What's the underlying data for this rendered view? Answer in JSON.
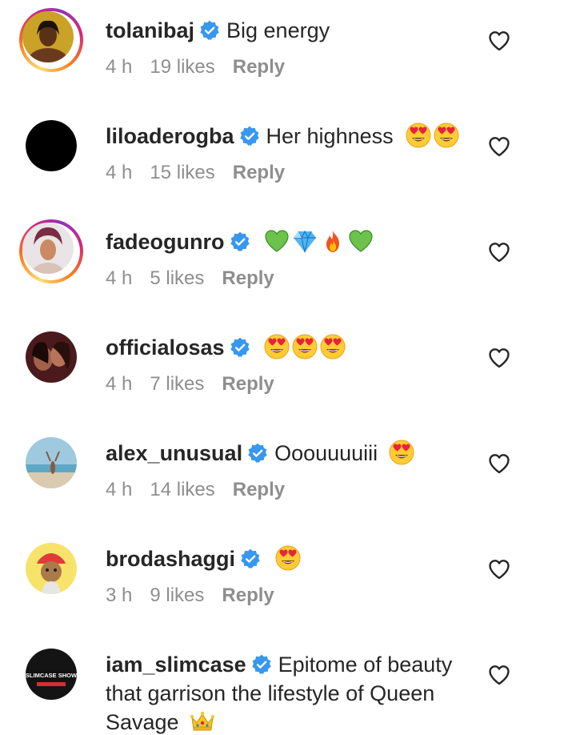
{
  "comments": [
    {
      "username": "tolanibaj",
      "text": "Big energy",
      "emojis": [],
      "time": "4 h",
      "likes": "19 likes",
      "reply": "Reply"
    },
    {
      "username": "liloaderogba",
      "text": "Her highness",
      "emojis": [
        "heart-eyes-emoji",
        "heart-eyes-emoji"
      ],
      "time": "4 h",
      "likes": "15 likes",
      "reply": "Reply"
    },
    {
      "username": "fadeogunro",
      "text": "",
      "emojis": [
        "green-heart-emoji",
        "gem-emoji",
        "fire-emoji",
        "green-heart-emoji"
      ],
      "time": "4 h",
      "likes": "5 likes",
      "reply": "Reply"
    },
    {
      "username": "officialosas",
      "text": "",
      "emojis": [
        "heart-eyes-emoji",
        "heart-eyes-emoji",
        "heart-eyes-emoji"
      ],
      "time": "4 h",
      "likes": "7 likes",
      "reply": "Reply"
    },
    {
      "username": "alex_unusual",
      "text": "Ooouuuuiii",
      "emojis": [
        "heart-eyes-emoji"
      ],
      "time": "4 h",
      "likes": "14 likes",
      "reply": "Reply"
    },
    {
      "username": "brodashaggi",
      "text": "",
      "emojis": [
        "heart-eyes-emoji"
      ],
      "time": "3 h",
      "likes": "9 likes",
      "reply": "Reply"
    },
    {
      "username": "iam_slimcase",
      "text_line1": "Epitome of beauty",
      "text_line2": "that garrison the lifestyle of Queen",
      "text_line3": "Savage",
      "emojis": [
        "crown-emoji"
      ]
    }
  ],
  "avatar_logo_text": "SLIMCASE SHOW",
  "colors": {
    "verified": "#3897f0",
    "muted": "#8e8e8e",
    "text": "#262626"
  }
}
